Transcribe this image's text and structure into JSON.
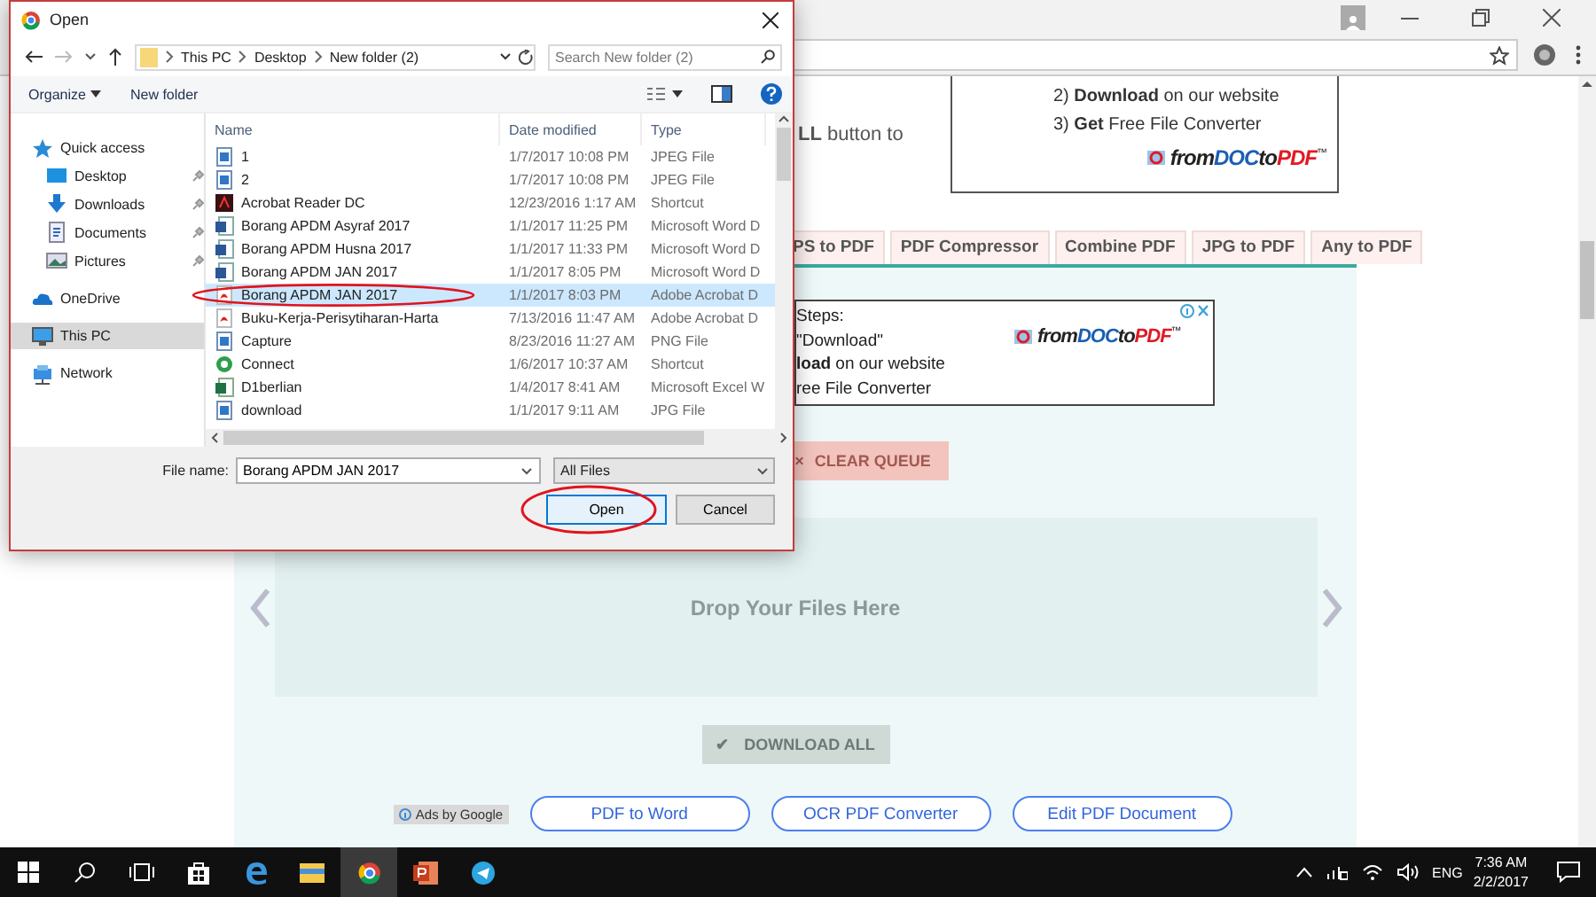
{
  "dialog": {
    "title": "Open",
    "breadcrumb": [
      "This PC",
      "Desktop",
      "New folder (2)"
    ],
    "search": {
      "placeholder": "Search New folder (2)"
    },
    "toolbar": [
      {
        "label": "Organize",
        "kind": "menu"
      },
      {
        "label": "New folder",
        "kind": "button"
      }
    ],
    "sidebar": [
      {
        "label": "Quick access",
        "selected": false,
        "children": [
          {
            "label": "Desktop",
            "selected": false,
            "pinned": true
          },
          {
            "label": "Downloads",
            "selected": false,
            "pinned": true
          },
          {
            "label": "Documents",
            "selected": false,
            "pinned": true
          },
          {
            "label": "Pictures",
            "selected": false,
            "pinned": true
          }
        ]
      },
      {
        "label": "OneDrive",
        "selected": false
      },
      {
        "label": "This PC",
        "selected": true
      },
      {
        "label": "Network",
        "selected": false
      }
    ],
    "columns": [
      "Name",
      "Date modified",
      "Type"
    ],
    "files": [
      {
        "name": "1",
        "date": "1/7/2017 10:08 PM",
        "type": "JPEG File",
        "kind": "image",
        "selected": false,
        "circled": false
      },
      {
        "name": "2",
        "date": "1/7/2017 10:08 PM",
        "type": "JPEG File",
        "kind": "image",
        "selected": false,
        "circled": false
      },
      {
        "name": "Acrobat Reader DC",
        "date": "12/23/2016 1:17 AM",
        "type": "Shortcut",
        "kind": "app",
        "selected": false,
        "circled": false
      },
      {
        "name": "Borang APDM Asyraf 2017",
        "date": "1/1/2017 11:25 PM",
        "type": "Microsoft Word D",
        "kind": "word",
        "selected": false,
        "circled": false
      },
      {
        "name": "Borang APDM Husna 2017",
        "date": "1/1/2017 11:33 PM",
        "type": "Microsoft Word D",
        "kind": "word",
        "selected": false,
        "circled": false
      },
      {
        "name": "Borang APDM JAN 2017",
        "date": "1/1/2017 8:05 PM",
        "type": "Microsoft Word D",
        "kind": "word",
        "selected": false,
        "circled": false
      },
      {
        "name": "Borang APDM JAN 2017",
        "date": "1/1/2017 8:03 PM",
        "type": "Adobe Acrobat D",
        "kind": "pdf",
        "selected": true,
        "circled": true
      },
      {
        "name": "Buku-Kerja-Perisytiharan-Harta",
        "date": "7/13/2016 11:47 AM",
        "type": "Adobe Acrobat D",
        "kind": "pdf",
        "selected": false,
        "circled": false
      },
      {
        "name": "Capture",
        "date": "8/23/2016 11:27 AM",
        "type": "PNG File",
        "kind": "image",
        "selected": false,
        "circled": false
      },
      {
        "name": "Connect",
        "date": "1/6/2017 10:37 AM",
        "type": "Shortcut",
        "kind": "link",
        "selected": false,
        "circled": false
      },
      {
        "name": "D1berlian",
        "date": "1/4/2017 8:41 AM",
        "type": "Microsoft Excel W",
        "kind": "excel",
        "selected": false,
        "circled": false
      },
      {
        "name": "download",
        "date": "1/1/2017 9:11 AM",
        "type": "JPG File",
        "kind": "image",
        "selected": false,
        "circled": false
      }
    ],
    "file_name": {
      "label": "File name:",
      "value": "Borang APDM JAN 2017"
    },
    "filter": "All Files",
    "buttons": [
      {
        "label": "Open",
        "default": true,
        "circled": true
      },
      {
        "label": "Cancel",
        "default": false,
        "circled": false
      }
    ]
  },
  "page": {
    "intro_text": "**LL** button to",
    "top_ad": {
      "lines": [
        "2) **Download** on our website",
        "3) **Get** Free File Converter"
      ],
      "logo": {
        "parts": [
          "from",
          "DOC",
          "to",
          "PDF"
        ],
        "mark": "™"
      }
    },
    "tool_tabs": [
      {
        "label": "PS to PDF",
        "selected": false
      },
      {
        "label": "PDF Compressor",
        "selected": false
      },
      {
        "label": "Combine PDF",
        "selected": false
      },
      {
        "label": "JPG to PDF",
        "selected": false
      },
      {
        "label": "Any to PDF",
        "selected": false
      }
    ],
    "side_ad": {
      "lines": [
        "Steps:",
        "\"Download\"",
        "**load** on our website",
        "ree File Converter"
      ],
      "logo": {
        "parts": [
          "from",
          "DOC",
          "to",
          "PDF"
        ],
        "mark": "™"
      }
    },
    "clear_button": {
      "icon": "×",
      "label": "CLEAR QUEUE",
      "disabled": true
    },
    "drop_zone": "Drop Your Files Here",
    "download_button": {
      "icon": "✔",
      "label": "DOWNLOAD ALL",
      "disabled": true
    },
    "ads_label": "Ads by Google",
    "links": [
      "PDF to Word",
      "OCR PDF Converter",
      "Edit PDF Document"
    ]
  },
  "taskbar": {
    "language": "ENG",
    "time": "7:36 AM",
    "date": "2/2/2017"
  }
}
